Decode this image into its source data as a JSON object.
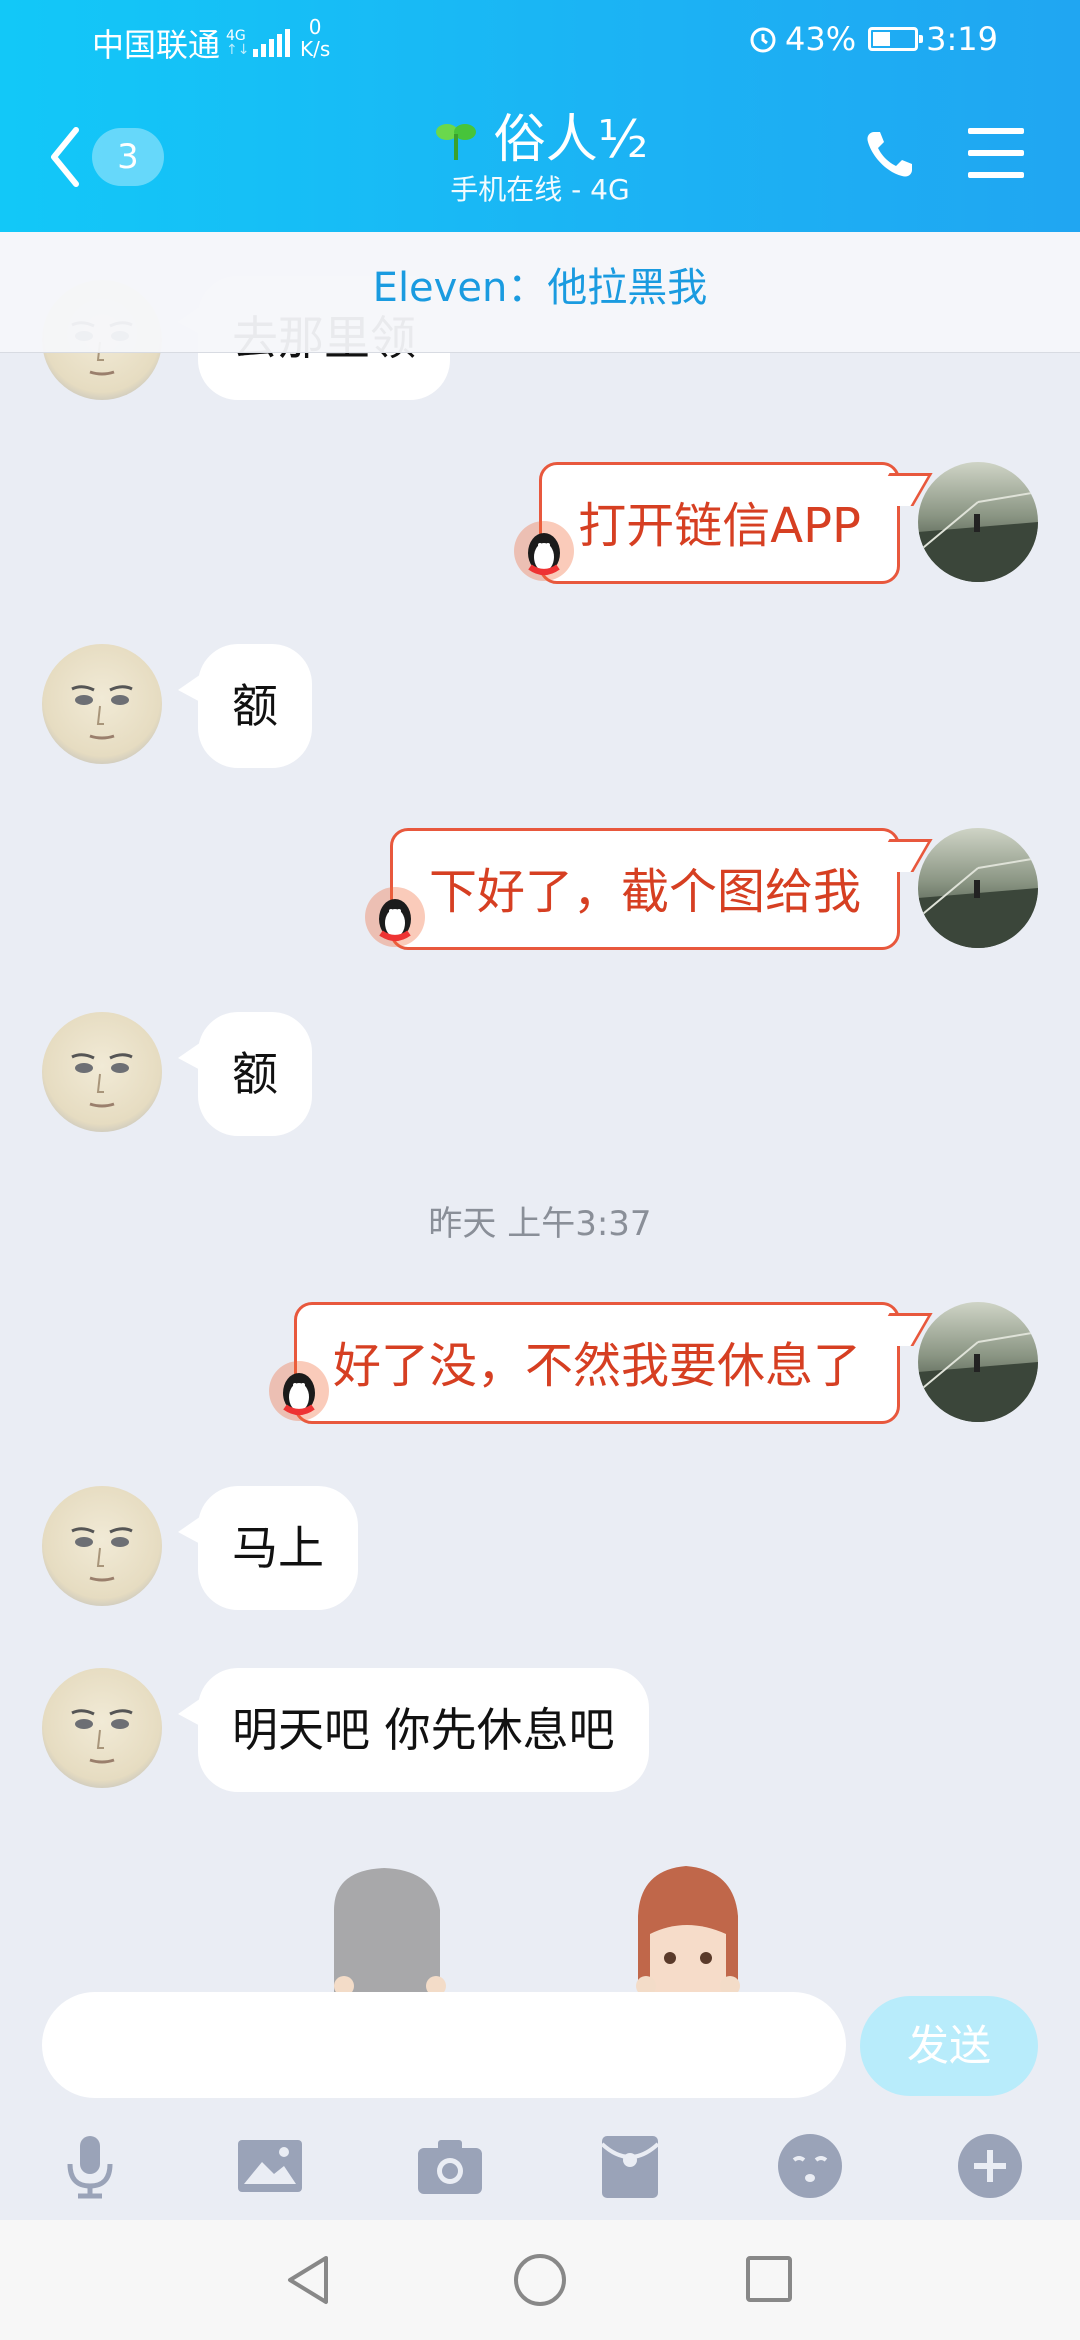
{
  "status_bar": {
    "carrier": "中国联通",
    "net_type": "4G",
    "speed_value": "0",
    "speed_unit": "K/s",
    "battery": "43%",
    "battery_level": 0.43,
    "time": "3:19"
  },
  "header": {
    "unread_count": "3",
    "title": "俗人½",
    "subtitle": "手机在线 - 4G"
  },
  "notice": {
    "text": "Eleven：他拉黑我"
  },
  "messages": [
    {
      "side": "left",
      "text": "去那里领"
    },
    {
      "side": "right",
      "text": "打开链信APP"
    },
    {
      "side": "left",
      "text": "额"
    },
    {
      "side": "right",
      "text": "下好了，截个图给我"
    },
    {
      "side": "left",
      "text": "额"
    },
    {
      "side": "right",
      "text": "好了没，不然我要休息了"
    },
    {
      "side": "left",
      "text": "马上"
    },
    {
      "side": "left",
      "text": "明天吧  你先休息吧"
    }
  ],
  "timestamp": "昨天 上午3:37",
  "input": {
    "placeholder": "",
    "send_label": "发送"
  },
  "toolbar": {
    "items": [
      "voice-icon",
      "image-icon",
      "camera-icon",
      "red-packet-icon",
      "emoji-icon",
      "plus-icon"
    ]
  },
  "colors": {
    "header_start": "#12c8f8",
    "header_end": "#20a6f2",
    "my_bubble_border": "#e8583d",
    "my_bubble_text": "#d63f22",
    "notice_text": "#1a9be0"
  }
}
